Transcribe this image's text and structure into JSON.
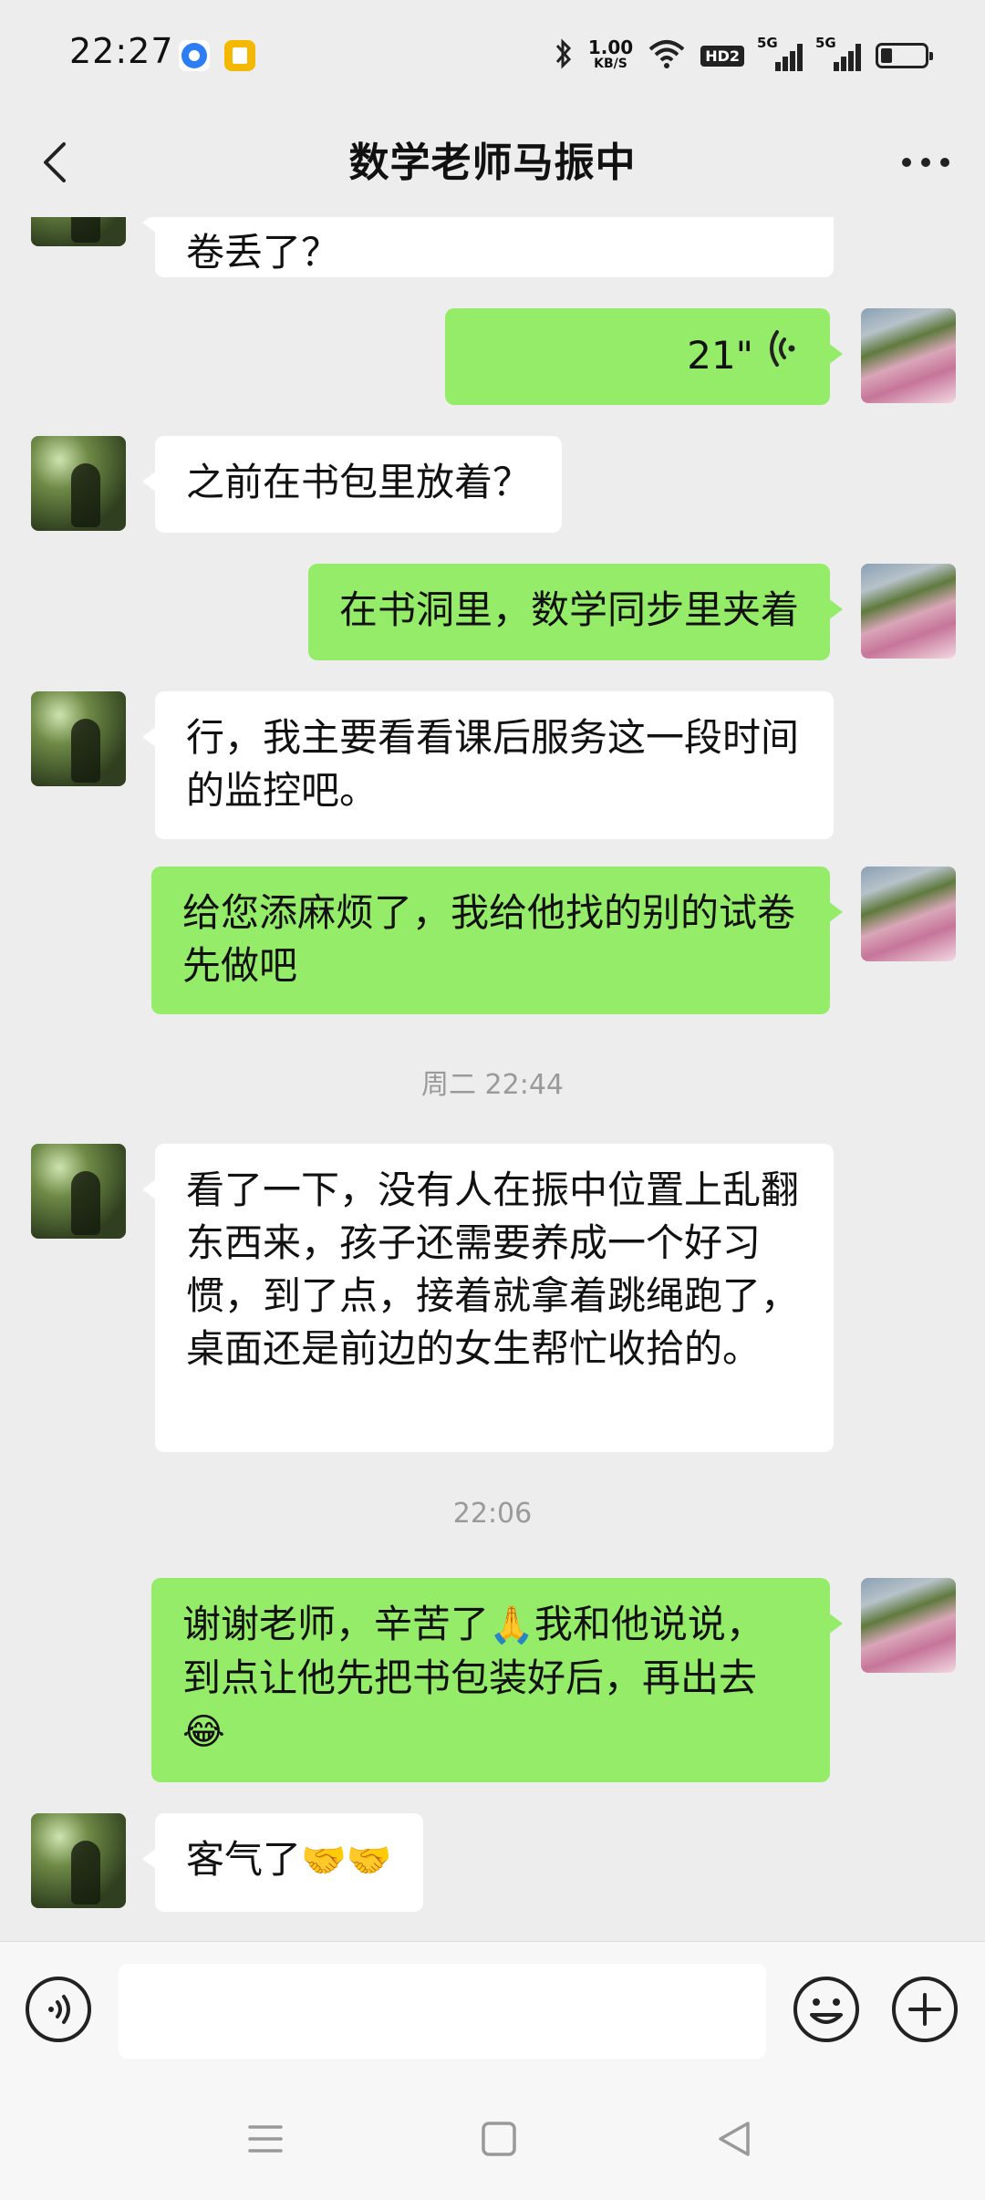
{
  "status_bar": {
    "time": "22:27",
    "net_speed_value": "1.00",
    "net_speed_unit": "KB/S",
    "hd_badge": "HD2",
    "signal1_label": "5G",
    "signal2_label": "5G",
    "battery_level": 0.25
  },
  "header": {
    "title": "数学老师马振中"
  },
  "messages": [
    {
      "side": "left",
      "text": "卷丢了？"
    },
    {
      "side": "right",
      "type": "voice",
      "duration": "21\""
    },
    {
      "side": "left",
      "text": "之前在书包里放着？"
    },
    {
      "side": "right",
      "text": "在书洞里，数学同步里夹着"
    },
    {
      "side": "left",
      "text": "行，我主要看看课后服务这一段时间的监控吧。"
    },
    {
      "side": "right",
      "text": "给您添麻烦了，我给他找的别的试卷先做吧"
    },
    {
      "type": "timestamp",
      "text": "周二 22:44"
    },
    {
      "side": "left",
      "text": "看了一下，没有人在振中位置上乱翻东西来，孩子还需要养成一个好习惯，到了点，接着就拿着跳绳跑了，桌面还是前边的女生帮忙收拾的。"
    },
    {
      "type": "timestamp",
      "text": "22:06"
    },
    {
      "side": "right",
      "text_part1": "谢谢老师，辛苦了",
      "emoji1": "🙏",
      "text_part2": "我和他说说，到点让他先把书包装好后，再出去",
      "emoji2": "😂"
    },
    {
      "side": "left",
      "text": "客气了",
      "emoji": "🤝🤝"
    }
  ],
  "icons": {
    "back": "chevron-left-icon",
    "more": "more-dots-icon",
    "voice_input": "voice-input-icon",
    "emoji": "emoji-icon",
    "plus": "plus-icon",
    "nav_menu": "menu-icon",
    "nav_home": "home-square-icon",
    "nav_back": "back-triangle-icon"
  },
  "colors": {
    "background": "#ededed",
    "my_bubble": "#95ec69",
    "their_bubble": "#ffffff",
    "timestamp": "#9a9a9a"
  }
}
